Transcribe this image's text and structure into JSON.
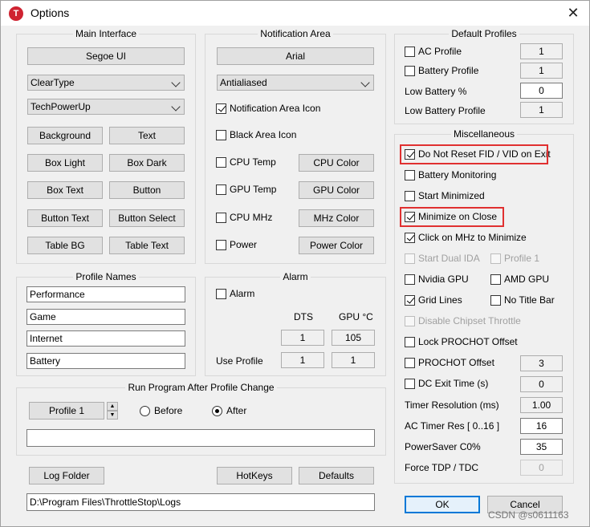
{
  "window": {
    "title": "Options",
    "app_icon_letter": "T"
  },
  "main_interface": {
    "title": "Main Interface",
    "font_button": "Segoe UI",
    "render_select": "ClearType",
    "theme_select": "TechPowerUp",
    "buttons": [
      "Background",
      "Text",
      "Box Light",
      "Box Dark",
      "Box Text",
      "Button",
      "Button Text",
      "Button Select",
      "Table BG",
      "Table Text"
    ]
  },
  "notification_area": {
    "title": "Notification Area",
    "font_button": "Arial",
    "render_select": "Antialiased",
    "notification_icon": "Notification Area Icon",
    "black_icon": "Black Area Icon",
    "rows": [
      {
        "label": "CPU Temp",
        "button": "CPU Color"
      },
      {
        "label": "GPU Temp",
        "button": "GPU Color"
      },
      {
        "label": "CPU MHz",
        "button": "MHz Color"
      },
      {
        "label": "Power",
        "button": "Power Color"
      }
    ]
  },
  "default_profiles": {
    "title": "Default Profiles",
    "ac_profile": {
      "label": "AC Profile",
      "value": "1"
    },
    "battery_profile": {
      "label": "Battery Profile",
      "value": "1"
    },
    "low_battery_pct": {
      "label": "Low Battery %",
      "value": "0"
    },
    "low_battery_profile": {
      "label": "Low Battery Profile",
      "value": "1"
    }
  },
  "profile_names": {
    "title": "Profile Names",
    "names": [
      "Performance",
      "Game",
      "Internet",
      "Battery"
    ]
  },
  "alarm": {
    "title": "Alarm",
    "alarm_label": "Alarm",
    "dts_header": "DTS",
    "gpu_header": "GPU °C",
    "dts_value": "1",
    "gpu_value": "105",
    "use_profile_label": "Use Profile",
    "use_dts": "1",
    "use_gpu": "1"
  },
  "run_program": {
    "title": "Run Program After Profile Change",
    "profile_button": "Profile 1",
    "before": "Before",
    "after": "After",
    "path": ""
  },
  "misc": {
    "title": "Miscellaneous",
    "do_not_reset": "Do Not Reset FID / VID on Exit",
    "battery_monitoring": "Battery Monitoring",
    "start_minimized": "Start Minimized",
    "minimize_on_close": "Minimize on Close",
    "click_on_mhz": "Click on MHz to Minimize",
    "start_dual_ida": "Start Dual IDA",
    "profile_1": "Profile 1",
    "nvidia_gpu": "Nvidia GPU",
    "amd_gpu": "AMD GPU",
    "grid_lines": "Grid Lines",
    "no_title_bar": "No Title Bar",
    "disable_chipset": "Disable Chipset Throttle",
    "lock_prochot": "Lock PROCHOT Offset",
    "prochot_offset": {
      "label": "PROCHOT Offset",
      "value": "3"
    },
    "dc_exit_time": {
      "label": "DC Exit Time (s)",
      "value": "0"
    },
    "timer_resolution": {
      "label": "Timer Resolution (ms)",
      "value": "1.00"
    },
    "ac_timer_res": {
      "label": "AC Timer Res [ 0..16 ]",
      "value": "16"
    },
    "powersaver": {
      "label": "PowerSaver C0%",
      "value": "35"
    },
    "force_tdp": {
      "label": "Force TDP / TDC",
      "value": "0"
    }
  },
  "bottom": {
    "log_folder": "Log Folder",
    "hotkeys": "HotKeys",
    "defaults": "Defaults",
    "log_path": "D:\\Program Files\\ThrottleStop\\Logs",
    "ok": "OK",
    "cancel": "Cancel"
  },
  "watermark": "CSDN @s0611163",
  "colors": {
    "highlight": "#e03030",
    "ok_border": "#0078d7",
    "app_icon": "#cf2331"
  }
}
